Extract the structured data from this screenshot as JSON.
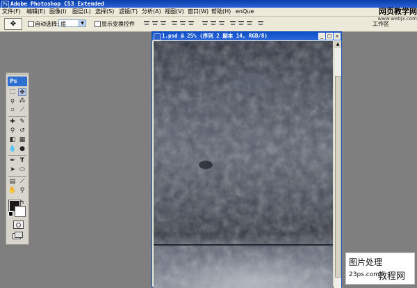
{
  "window": {
    "title": "Adobe Photoshop CS3 Extended"
  },
  "menu": [
    "文件(F)",
    "编辑(E)",
    "图像(I)",
    "图层(L)",
    "选择(S)",
    "滤镜(T)",
    "分析(A)",
    "视图(V)",
    "窗口(W)",
    "帮助(H)",
    "enQue"
  ],
  "options": {
    "auto_select_label": "自动选择:",
    "auto_select_value": "组",
    "show_transform_label": "显示变换控件",
    "workspace_label": "工作区"
  },
  "watermark": {
    "text": "网页教学网",
    "url": "www.webjx.com"
  },
  "toolbox": {
    "logo": "Ps"
  },
  "document": {
    "title": "1.psd @ 25% (序列 2 副本 14, RGB/8)"
  },
  "stamp": {
    "line1": "图片处理",
    "line2": "23ps.com",
    "line3": "教程网"
  },
  "colors": {
    "title_blue": "#2a62d8",
    "chrome": "#ece9d8",
    "workspace": "#7f7f7f"
  }
}
